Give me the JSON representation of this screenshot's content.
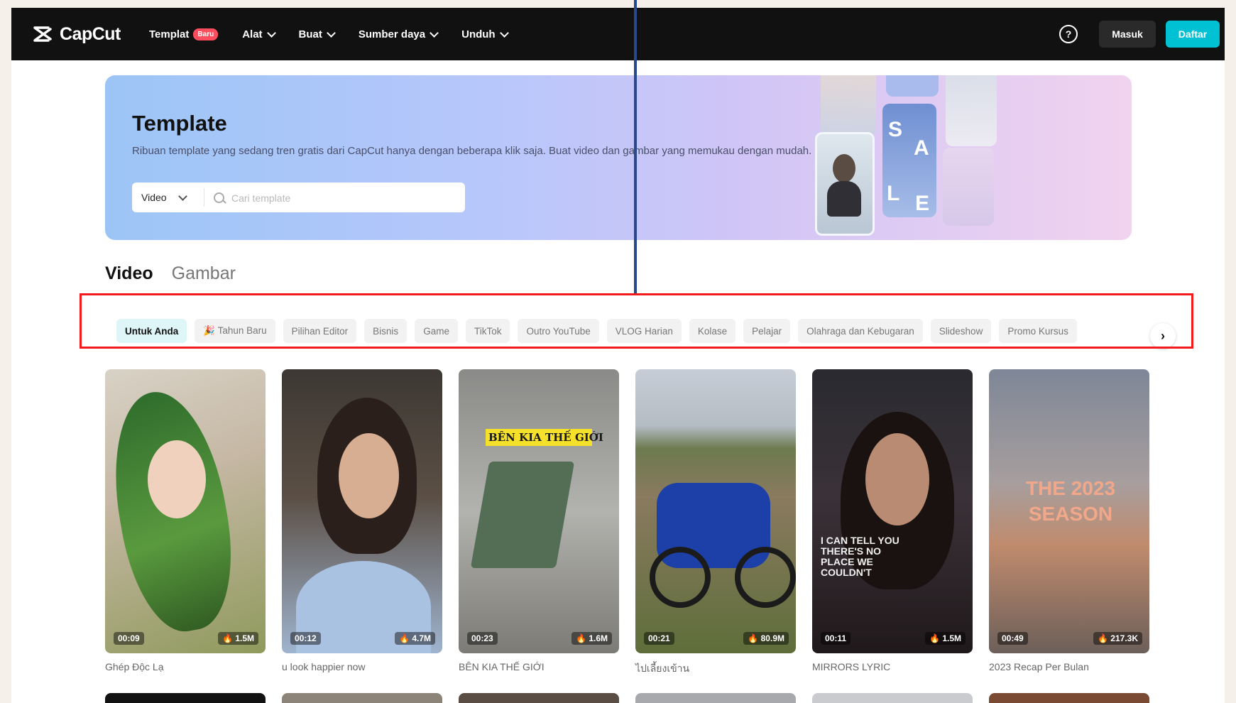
{
  "brand": {
    "name": "CapCut"
  },
  "nav": {
    "items": [
      {
        "label": "Templat",
        "badge": "Baru"
      },
      {
        "label": "Alat"
      },
      {
        "label": "Buat"
      },
      {
        "label": "Sumber daya"
      },
      {
        "label": "Unduh"
      }
    ],
    "help_icon": "question-circle-icon",
    "login": "Masuk",
    "signup": "Daftar"
  },
  "hero": {
    "title": "Template",
    "description": "Ribuan template yang sedang tren gratis dari CapCut hanya dengan beberapa klik saja. Buat video dan gambar yang memukau dengan mudah.",
    "search": {
      "type_selected": "Video",
      "placeholder": "Cari template"
    }
  },
  "tabs": [
    {
      "label": "Video",
      "active": true
    },
    {
      "label": "Gambar",
      "active": false
    }
  ],
  "chips": [
    {
      "label": "Untuk Anda",
      "active": true
    },
    {
      "label": "🎉 Tahun Baru"
    },
    {
      "label": "Pilihan Editor"
    },
    {
      "label": "Bisnis"
    },
    {
      "label": "Game"
    },
    {
      "label": "TikTok"
    },
    {
      "label": "Outro YouTube"
    },
    {
      "label": "VLOG Harian"
    },
    {
      "label": "Kolase"
    },
    {
      "label": "Pelajar"
    },
    {
      "label": "Olahraga dan Kebugaran"
    },
    {
      "label": "Slideshow"
    },
    {
      "label": "Promo Kursus"
    }
  ],
  "cards": [
    {
      "title": "Ghép Độc Lạ",
      "duration": "00:09",
      "uses": "1.5M"
    },
    {
      "title": "u look happier now",
      "duration": "00:12",
      "uses": "4.7M"
    },
    {
      "title": "BÊN KIA THẾ GIỚI",
      "duration": "00:23",
      "uses": "1.6M",
      "overlay": "BÊN KIA THẾ GIỚI"
    },
    {
      "title": "ไปเลี้ยงเข้าน",
      "duration": "00:21",
      "uses": "80.9M"
    },
    {
      "title": "MIRRORS LYRIC",
      "duration": "00:11",
      "uses": "1.5M",
      "overlay": "I CAN TELL YOU THERE'S NO PLACE WE COULDN'T"
    },
    {
      "title": "2023 Recap Per Bulan",
      "duration": "00:49",
      "uses": "217.3K",
      "overlay": "THE 2023 SEASON"
    }
  ]
}
